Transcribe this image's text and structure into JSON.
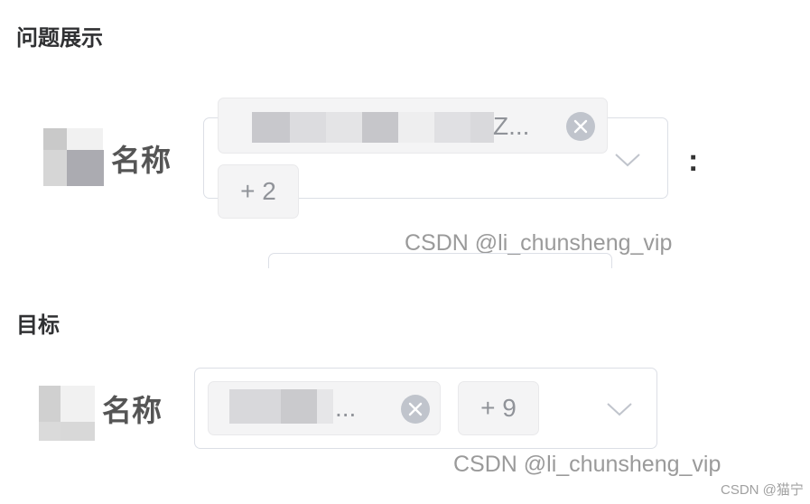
{
  "sections": [
    {
      "title": "问题展示",
      "label": "名称",
      "tag_text": "Z...",
      "more_tag": "+ 2",
      "suffix": ":"
    },
    {
      "title": "目标",
      "label": "名称",
      "tag_text": "...",
      "more_tag": "+ 9"
    }
  ],
  "watermarks": [
    "CSDN @li_chunsheng_vip",
    "CSDN @li_chunsheng_vip"
  ],
  "footer_watermark": "CSDN @猫宁",
  "icons": {
    "tag_close": "close-circle-icon",
    "select_arrow": "chevron-down-icon"
  },
  "colors": {
    "border": "#dcdfe6",
    "tag_background": "#f4f4f5",
    "tag_text": "#909399",
    "close_icon": "#c0c4cc"
  }
}
